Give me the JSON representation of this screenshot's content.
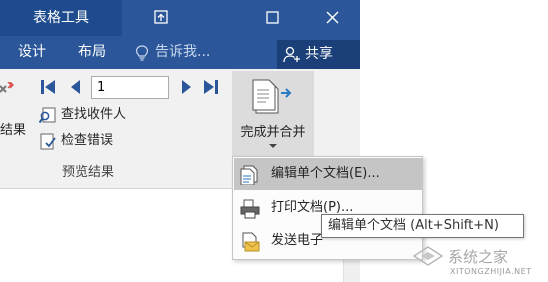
{
  "title_bar": {
    "context_tab": "表格工具"
  },
  "tabs": {
    "design": "设计",
    "layout": "布局",
    "tell_me": "告诉我...",
    "share": "共享"
  },
  "ribbon": {
    "left_fragment_label": "结果",
    "record_number": "1",
    "find_recipient": "查找收件人",
    "check_errors": "检查错误",
    "group_label": "预览结果",
    "finish_merge": "完成并合并"
  },
  "menu": {
    "items": [
      {
        "label": "编辑单个文档(E)...",
        "icon": "edit-documents-icon"
      },
      {
        "label": "打印文档(P)...",
        "icon": "print-documents-icon"
      },
      {
        "label": "发送电子",
        "icon": "send-email-icon"
      }
    ]
  },
  "tooltip": {
    "text": "编辑单个文档 (Alt+Shift+N)"
  },
  "watermark": {
    "text": "系统之家",
    "url": "XITONGZHIJIA.NET"
  },
  "colors": {
    "title_bar": "#2b579a",
    "context_tab": "#1e4a8e",
    "share_button": "#1b3f78",
    "ribbon": "#f1f1f1",
    "accent_blue": "#2b579a"
  }
}
